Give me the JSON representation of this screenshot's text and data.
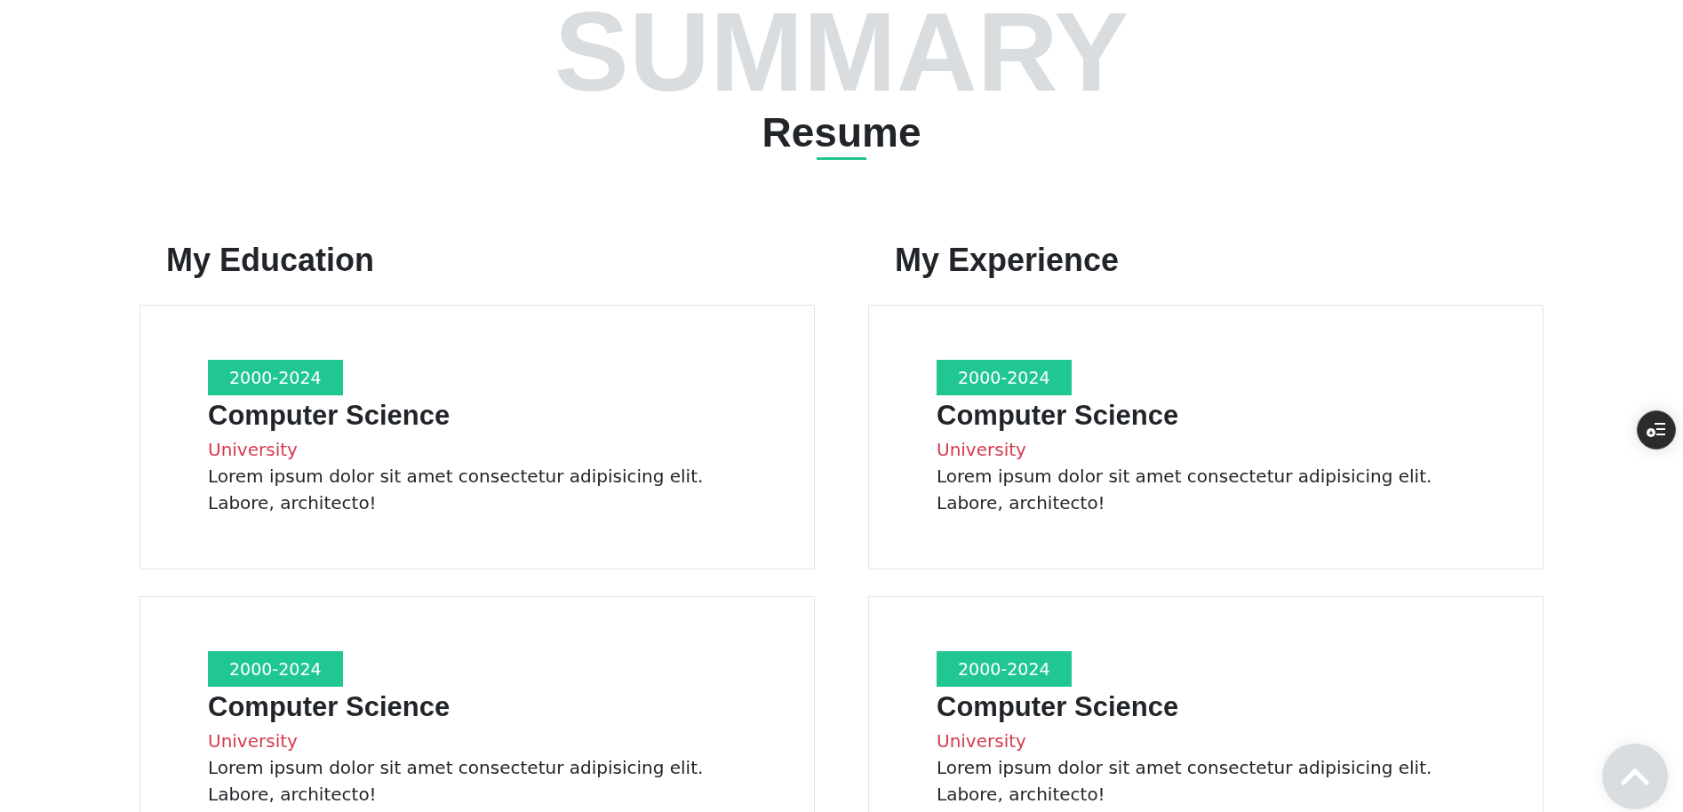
{
  "section": {
    "watermark": "SUMMARY",
    "title": "Resume"
  },
  "columns": [
    {
      "heading": "My Education",
      "entries": [
        {
          "period": "2000-2024",
          "title": "Computer Science",
          "place": "University",
          "description": "Lorem ipsum dolor sit amet consectetur adipisicing elit. Labore, architecto!"
        },
        {
          "period": "2000-2024",
          "title": "Computer Science",
          "place": "University",
          "description": "Lorem ipsum dolor sit amet consectetur adipisicing elit. Labore, architecto!"
        }
      ]
    },
    {
      "heading": "My Experience",
      "entries": [
        {
          "period": "2000-2024",
          "title": "Computer Science",
          "place": "University",
          "description": "Lorem ipsum dolor sit amet consectetur adipisicing elit. Labore, architecto!"
        },
        {
          "period": "2000-2024",
          "title": "Computer Science",
          "place": "University",
          "description": "Lorem ipsum dolor sit amet consectetur adipisicing elit. Labore, architecto!"
        }
      ]
    }
  ]
}
